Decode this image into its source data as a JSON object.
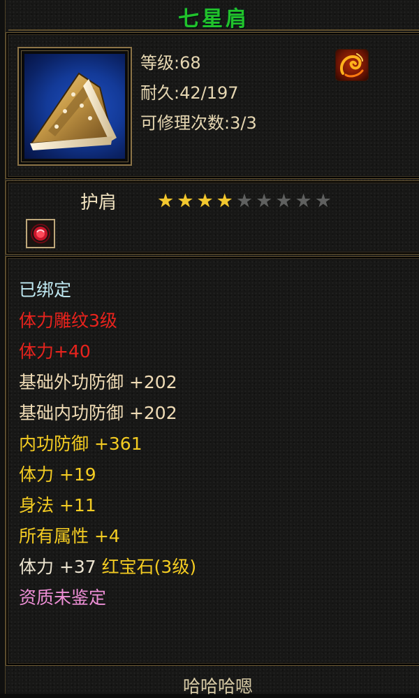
{
  "item": {
    "name": "七星肩",
    "level_text": "等级:68",
    "durability_text": "耐久:42/197",
    "repairs_text": "可修理次数:3/3",
    "type": "护肩",
    "stars_total": 9,
    "stars_filled": 4,
    "image_icon": "shoulder-armor-icon",
    "bind_badge_icon": "flame-swirl-icon",
    "gem_slot_icon": "ruby-gem-icon"
  },
  "attributes": [
    {
      "text": "已绑定",
      "color": "#bfe9f2"
    },
    {
      "text": "体力雕纹3级",
      "color": "#e8231d"
    },
    {
      "text": "体力+40",
      "color": "#e8231d"
    },
    {
      "text": "基础外功防御 +202",
      "color": "#f0dcb6"
    },
    {
      "text": "基础内功防御 +202",
      "color": "#f0dcb6"
    },
    {
      "text": "内功防御 +361",
      "color": "#f4cc22"
    },
    {
      "text": "体力 +19",
      "color": "#f4cc22"
    },
    {
      "text": "身法 +11",
      "color": "#f4cc22"
    },
    {
      "text": "所有属性 +4",
      "color": "#f4cc22"
    },
    {
      "text": "体力 +37 ",
      "color": "#ece4d0",
      "suffix": "红宝石(3级)",
      "suffix_color": "#f4cc22"
    },
    {
      "text": "资质未鉴定",
      "color": "#ee8fd6"
    }
  ],
  "footer": "哈哈哈嗯",
  "colors": {
    "title": "#22c22a",
    "frame": "#6d5a34",
    "star_on": "#f3c82f",
    "star_off": "#5f605f"
  }
}
